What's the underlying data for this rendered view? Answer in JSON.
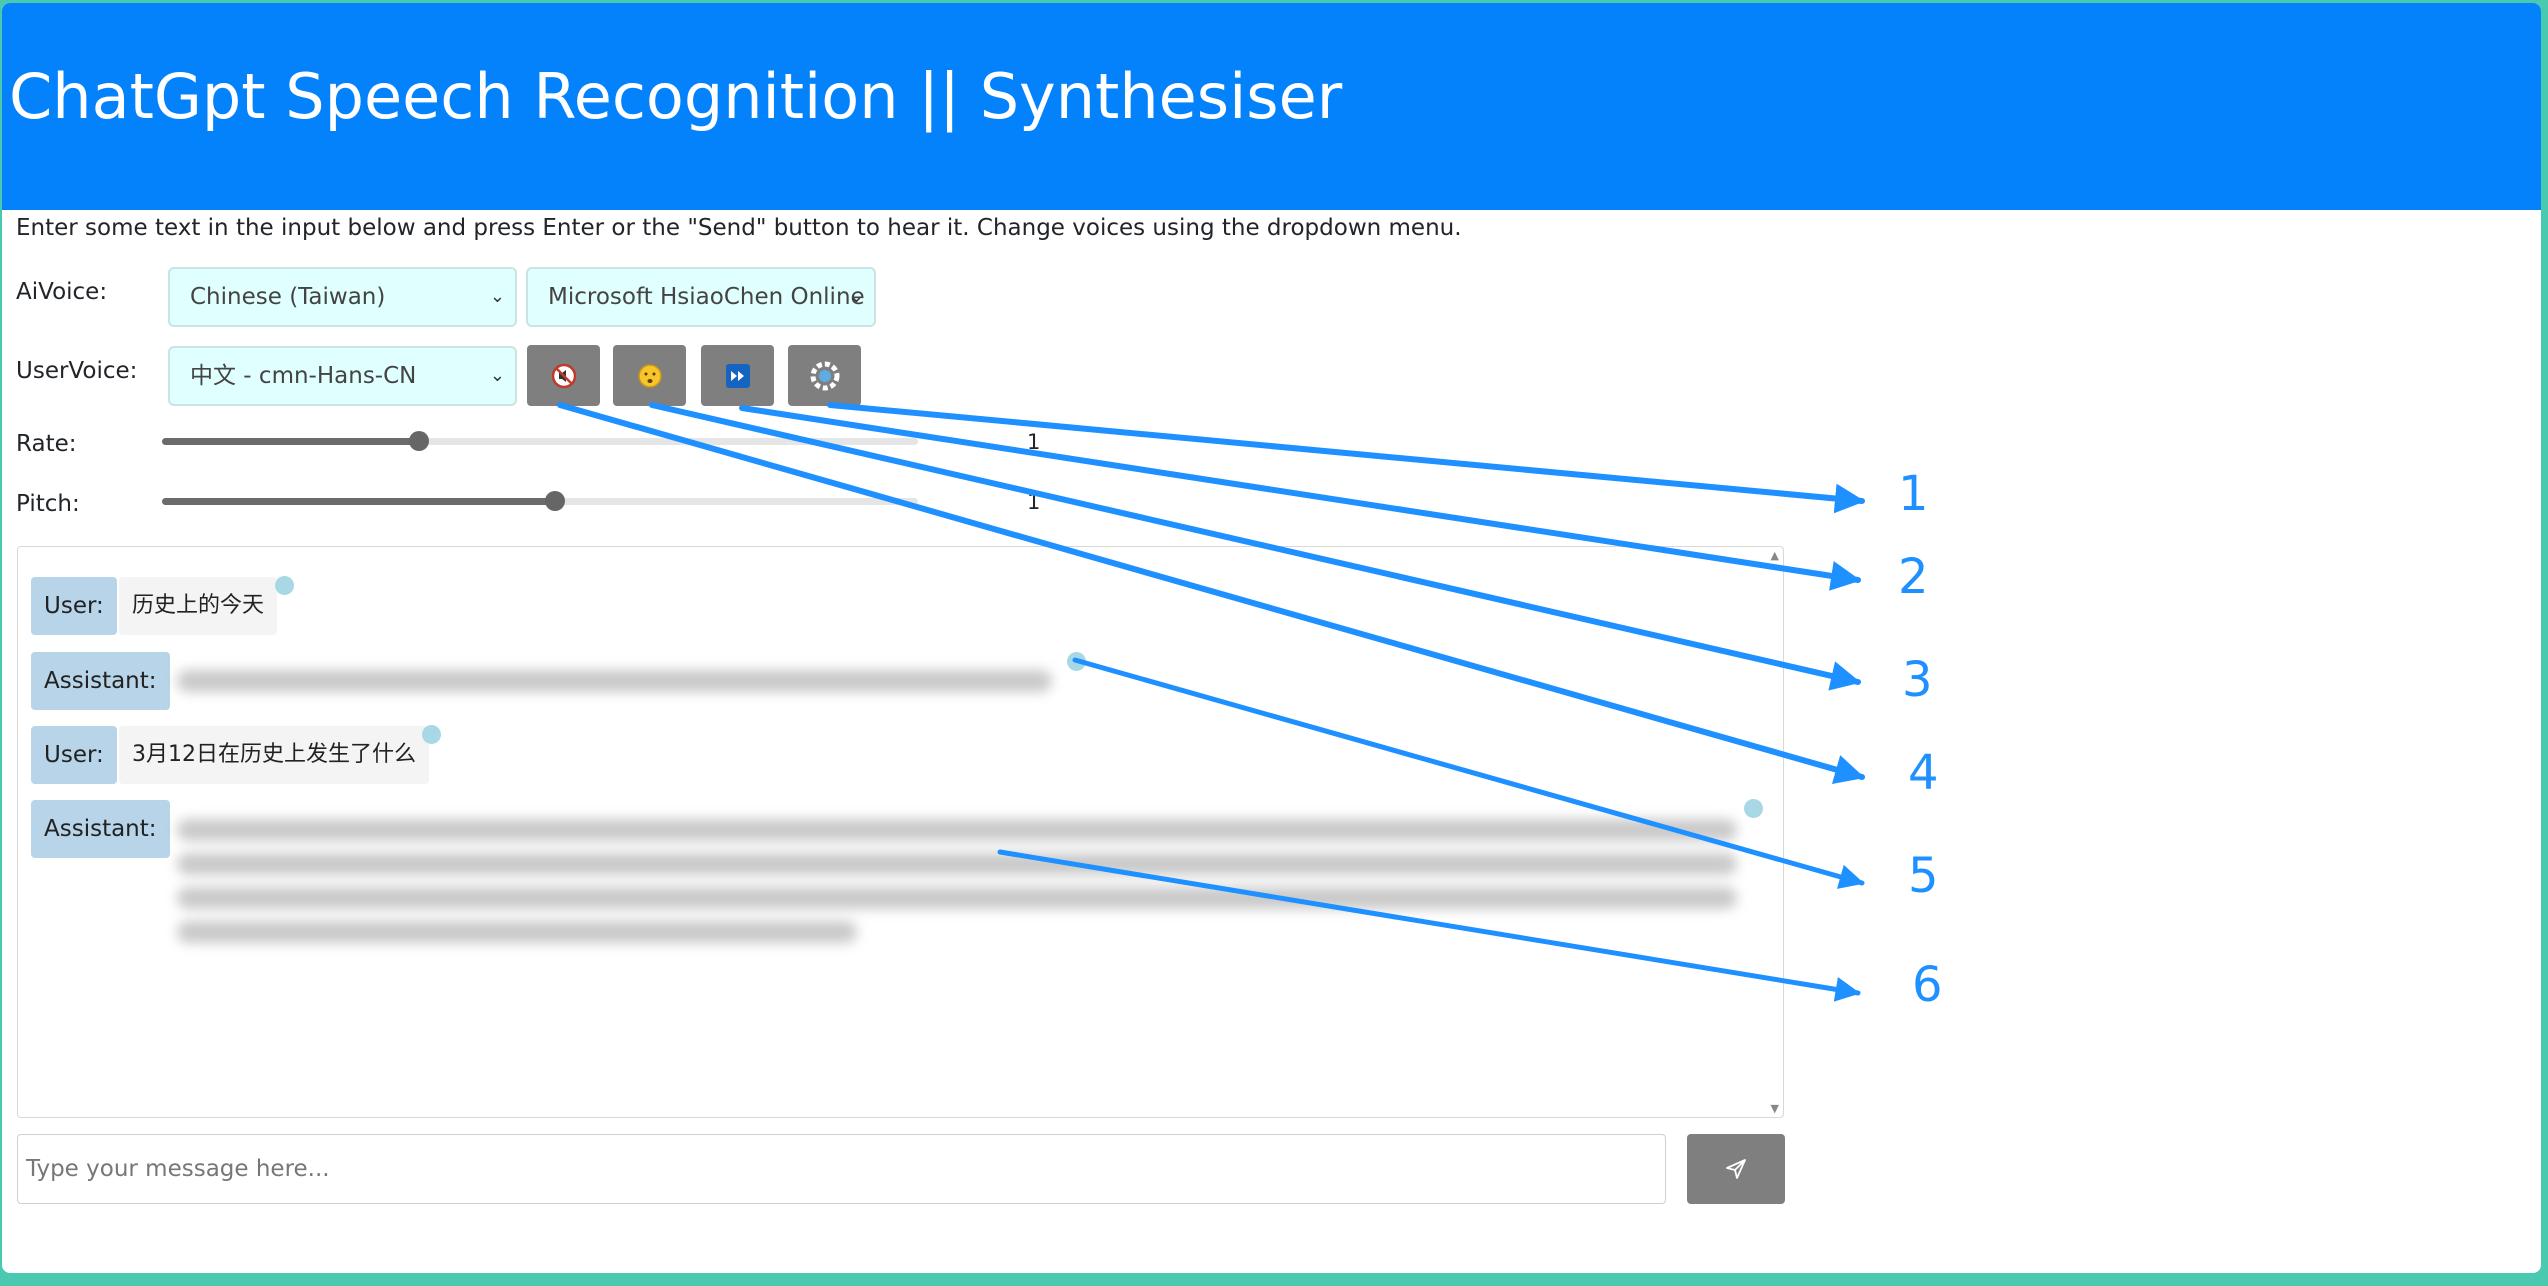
{
  "header": {
    "title": "ChatGpt Speech Recognition || Synthesiser"
  },
  "intro": "Enter some text in the input below and press Enter or the \"Send\" button to hear it. Change voices using the dropdown menu.",
  "ai_voice": {
    "label": "AiVoice:",
    "language": "Chinese (Taiwan)",
    "voice": "Microsoft HsiaoChen Online"
  },
  "user_voice": {
    "label": "UserVoice:",
    "language": "中文 - cmn-Hans-CN",
    "buttons": [
      {
        "icon": "mute-icon"
      },
      {
        "icon": "face-icon"
      },
      {
        "icon": "fast-forward-icon"
      },
      {
        "icon": "settings-icon"
      }
    ]
  },
  "rate": {
    "label": "Rate:",
    "value": "1",
    "fraction": 0.34
  },
  "pitch": {
    "label": "Pitch:",
    "value": "1",
    "fraction": 0.52
  },
  "chat": {
    "messages": [
      {
        "role": "User:",
        "text": "历史上的今天"
      },
      {
        "role": "Assistant:",
        "text": ""
      },
      {
        "role": "User:",
        "text": "3月12日在历史上发生了什么"
      },
      {
        "role": "Assistant:",
        "text": ""
      }
    ]
  },
  "input": {
    "placeholder": "Type your message here..."
  },
  "annotations": [
    "1",
    "2",
    "3",
    "4",
    "5",
    "6"
  ],
  "colors": {
    "header": "#0382fc",
    "arrow": "#1e90ff",
    "button": "#7f7f7f",
    "select_bg": "#e0ffff"
  }
}
